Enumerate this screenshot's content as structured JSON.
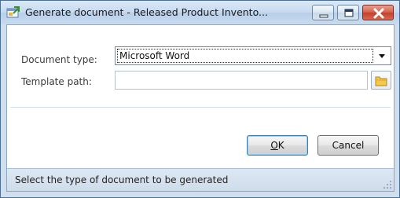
{
  "window": {
    "title": "Generate document - Released Product Invento...",
    "icon": "app-form-icon",
    "controls": [
      "minimize-icon",
      "maximize-icon",
      "close-icon"
    ]
  },
  "form": {
    "document_type": {
      "label": "Document type:",
      "value": "Microsoft Word"
    },
    "template_path": {
      "label": "Template path:",
      "value": "",
      "browse_icon": "folder-icon"
    }
  },
  "buttons": {
    "ok_underlined": "O",
    "ok_rest": "K",
    "cancel": "Cancel"
  },
  "status": {
    "text": "Select the type of document to be generated"
  },
  "colors": {
    "title_bar": "#c6daf0",
    "close_button": "#c3402b",
    "status_bar": "#d6e2ef"
  }
}
